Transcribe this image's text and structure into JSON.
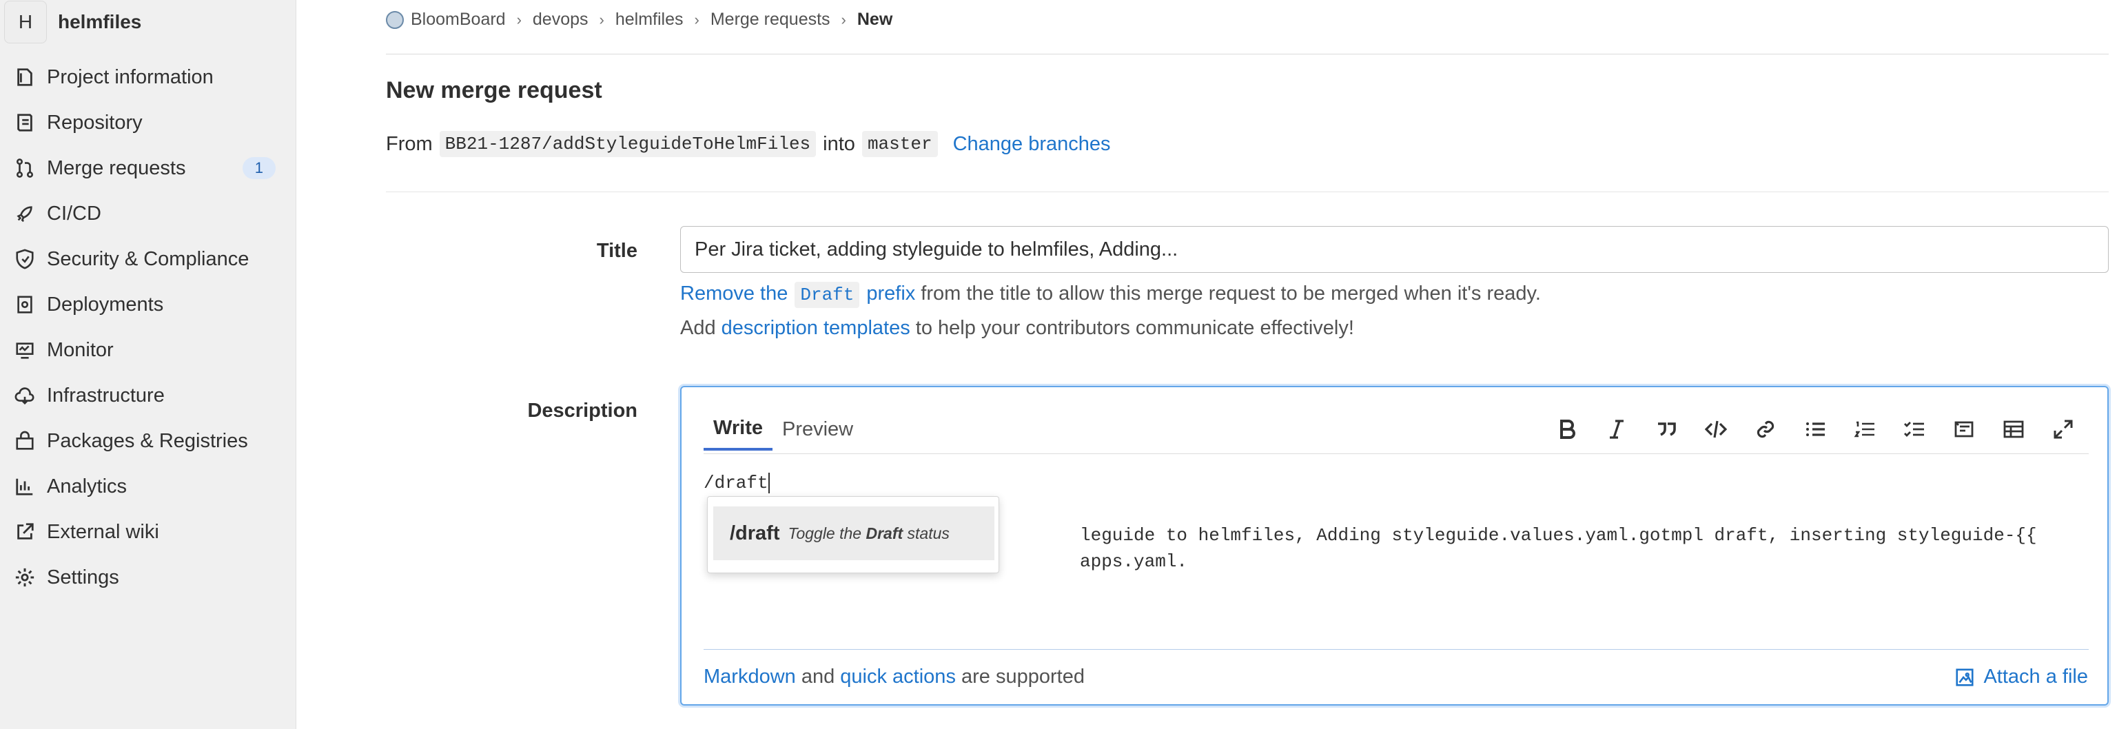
{
  "sidebar": {
    "avatar_letter": "H",
    "project_name": "helmfiles",
    "items": [
      {
        "label": "Project information",
        "icon": "document-icon"
      },
      {
        "label": "Repository",
        "icon": "repository-icon"
      },
      {
        "label": "Merge requests",
        "icon": "merge-request-icon",
        "badge": "1"
      },
      {
        "label": "CI/CD",
        "icon": "rocket-icon"
      },
      {
        "label": "Security & Compliance",
        "icon": "shield-icon"
      },
      {
        "label": "Deployments",
        "icon": "deployments-icon"
      },
      {
        "label": "Monitor",
        "icon": "monitor-icon"
      },
      {
        "label": "Infrastructure",
        "icon": "cloud-icon"
      },
      {
        "label": "Packages & Registries",
        "icon": "package-icon"
      },
      {
        "label": "Analytics",
        "icon": "chart-icon"
      },
      {
        "label": "External wiki",
        "icon": "external-link-icon"
      },
      {
        "label": "Settings",
        "icon": "gear-icon"
      }
    ]
  },
  "breadcrumb": {
    "items": [
      "BloomBoard",
      "devops",
      "helmfiles",
      "Merge requests"
    ],
    "current": "New"
  },
  "page": {
    "title": "New merge request",
    "from_label": "From",
    "source_branch": "BB21-1287/addStyleguideToHelmFiles",
    "into_label": "into",
    "target_branch": "master",
    "change_branches": "Change branches"
  },
  "form": {
    "title_label": "Title",
    "title_value": "Per Jira ticket, adding styleguide to helmfiles, Adding...",
    "hint1_link_a": "Remove the",
    "hint1_code": "Draft",
    "hint1_link_b": "prefix",
    "hint1_rest": "from the title to allow this merge request to be merged when it's ready.",
    "hint2_a": "Add",
    "hint2_link": "description templates",
    "hint2_b": "to help your contributors communicate effectively!",
    "description_label": "Description",
    "tab_write": "Write",
    "tab_preview": "Preview",
    "toolbar": [
      "bold-icon",
      "italic-icon",
      "quote-icon",
      "code-icon",
      "link-icon",
      "bullet-list-icon",
      "numbered-list-icon",
      "task-list-icon",
      "collapsible-icon",
      "table-icon",
      "fullscreen-icon"
    ],
    "text_line1": "/draft",
    "text_line2_hidden": "leguide to helmfiles, Adding styleguide.values.yaml.gotmpl draft, inserting styleguide-{{",
    "text_line3_hidden": "apps.yaml.",
    "autocomplete": {
      "command": "/draft",
      "desc_a": "Toggle the",
      "desc_bold": "Draft",
      "desc_b": "status"
    },
    "footer_markdown": "Markdown",
    "footer_and": "and",
    "footer_quick_actions": "quick actions",
    "footer_supported": "are supported",
    "attach_file": "Attach a file"
  }
}
